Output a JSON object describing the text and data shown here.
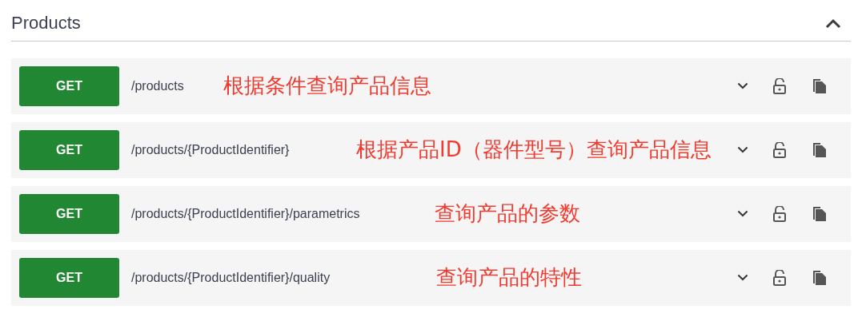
{
  "section": {
    "title": "Products",
    "expanded": true
  },
  "operations": [
    {
      "method": "GET",
      "path": "/products",
      "note": "根据条件查询产品信息",
      "expanded": false
    },
    {
      "method": "GET",
      "path": "/products/{ProductIdentifier}",
      "note": "根据产品ID（器件型号）查询产品信息",
      "expanded": false
    },
    {
      "method": "GET",
      "path": "/products/{ProductIdentifier}/parametrics",
      "note": "查询产品的参数",
      "expanded": false
    },
    {
      "method": "GET",
      "path": "/products/{ProductIdentifier}/quality",
      "note": "查询产品的特性",
      "expanded": false
    }
  ]
}
